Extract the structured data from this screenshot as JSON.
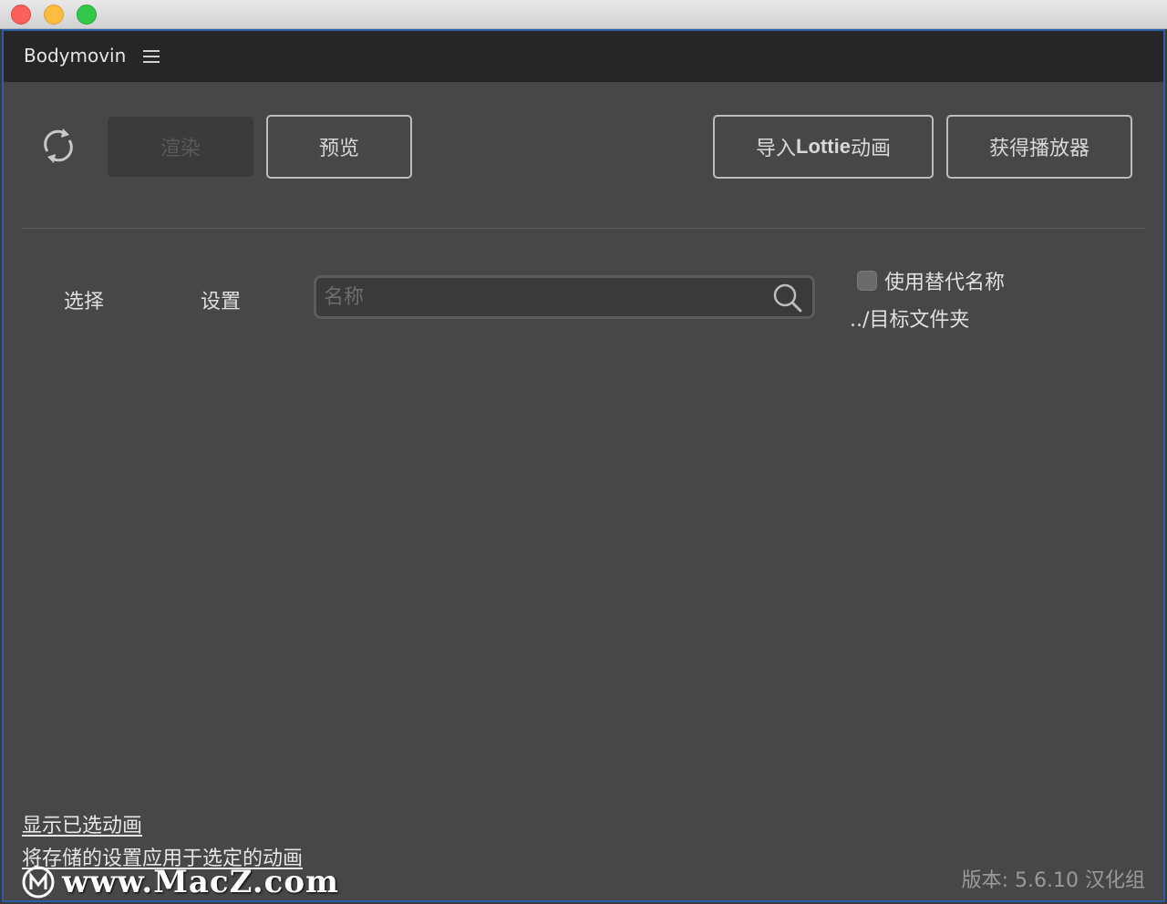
{
  "panel": {
    "title": "Bodymovin"
  },
  "toolbar": {
    "render_label": "渲染",
    "preview_label": "预览",
    "import_prefix": "导入",
    "import_bold": "Lottie",
    "import_suffix": "动画",
    "get_player_label": "获得播放器"
  },
  "list_header": {
    "select_label": "选择",
    "settings_label": "设置",
    "search_placeholder": "名称",
    "search_value": ""
  },
  "options": {
    "alt_name_label": "使用替代名称",
    "alt_name_checked": false,
    "destination_label": "../目标文件夹"
  },
  "footer": {
    "show_selected_label": "显示已选动画",
    "apply_settings_label": "将存储的设置应用于选定的动画",
    "version_label": "版本: 5.6.10 汉化组"
  },
  "watermark": {
    "text": "www.MacZ.com"
  },
  "colors": {
    "panel_bg": "#474747",
    "header_bg": "#262626",
    "window_border": "#2b5da8",
    "traffic_red": "#fc605b",
    "traffic_yellow": "#fdbc40",
    "traffic_green": "#34c84a"
  }
}
